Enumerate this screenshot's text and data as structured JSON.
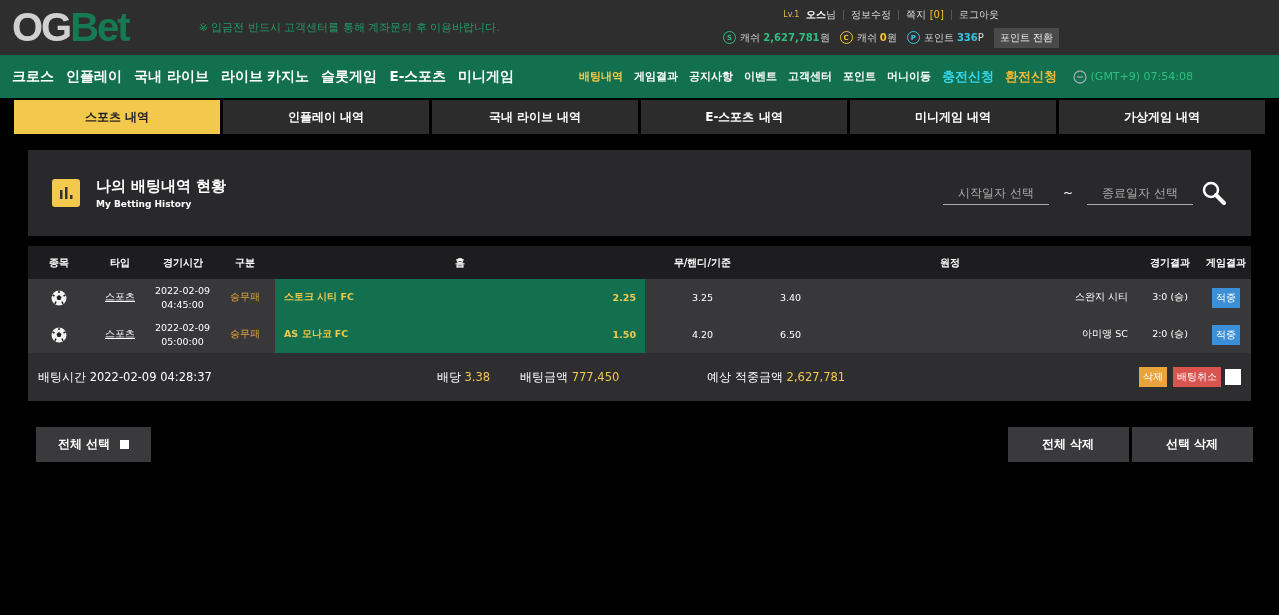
{
  "logo": {
    "part_1": "OG",
    "part_2": "Bet"
  },
  "notice": "※ 입금전 반드시 고객센터를 통해 계좌문의 후 이용바랍니다.",
  "user": {
    "level": "Lv.1",
    "name": "오스",
    "suffix": "님",
    "links": [
      "정보수정",
      "쪽지",
      "로그아웃"
    ],
    "message_count": "[0]"
  },
  "wallet": [
    {
      "kind": "s",
      "icon": "S",
      "label": "캐쉬",
      "amount": "2,627,781",
      "unit": "원"
    },
    {
      "kind": "c",
      "icon": "C",
      "label": "캐쉬",
      "amount": "0",
      "unit": "원"
    },
    {
      "kind": "p",
      "icon": "P",
      "label": "포인트",
      "amount": "336",
      "unit": "P"
    }
  ],
  "convert_button": "포인트 전환",
  "main_nav": [
    "크로스",
    "인플레이",
    "국내 라이브",
    "라이브 카지노",
    "슬롯게임",
    "E-스포츠",
    "미니게임"
  ],
  "sub_nav": [
    {
      "label": "배팅내역",
      "kind": "normal",
      "selected": true
    },
    {
      "label": "게임결과",
      "kind": "normal",
      "selected": false
    },
    {
      "label": "공지사항",
      "kind": "normal",
      "selected": false
    },
    {
      "label": "이벤트",
      "kind": "normal",
      "selected": false
    },
    {
      "label": "고객센터",
      "kind": "normal",
      "selected": false
    },
    {
      "label": "포인트",
      "kind": "normal",
      "selected": false
    },
    {
      "label": "머니이동",
      "kind": "normal",
      "selected": false
    },
    {
      "label": "충전신청",
      "kind": "charge",
      "selected": false
    },
    {
      "label": "환전신청",
      "kind": "exchange",
      "selected": false
    }
  ],
  "clock": "(GMT+9)  07:54:08",
  "tabs": [
    {
      "label": "스포츠 내역",
      "selected": true
    },
    {
      "label": "인플레이 내역",
      "selected": false
    },
    {
      "label": "국내 라이브 내역",
      "selected": false
    },
    {
      "label": "E-스포츠 내역",
      "selected": false
    },
    {
      "label": "미니게임 내역",
      "selected": false
    },
    {
      "label": "가상게임 내역",
      "selected": false
    }
  ],
  "panel": {
    "title": "나의 배팅내역 현황",
    "subtitle": "My Betting History",
    "start_placeholder": "시작일자 선택",
    "separator": "~",
    "end_placeholder": "종료일자 선택"
  },
  "table": {
    "columns": [
      "종목",
      "타입",
      "경기시간",
      "구분",
      "홈",
      "무/핸디/기준",
      "원정",
      "경기결과",
      "게임결과"
    ],
    "rows": [
      {
        "type": "스포츠",
        "date": "2022-02-09",
        "time": "04:45:00",
        "category": "승무패",
        "home": "스토크 시티 FC",
        "home_odds": "2.25",
        "home_selected": true,
        "draw": "3.25",
        "away_odds": "3.40",
        "away": "스완지 시티",
        "score": "3:0 (승)",
        "result": "적중"
      },
      {
        "type": "스포츠",
        "date": "2022-02-09",
        "time": "05:00:00",
        "category": "승무패",
        "home": "AS 모나코 FC",
        "home_odds": "1.50",
        "home_selected": true,
        "draw": "4.20",
        "away_odds": "6.50",
        "away": "아미앵 SC",
        "score": "2:0 (승)",
        "result": "적중"
      }
    ]
  },
  "summary": {
    "bet_time_label": "배팅시간",
    "bet_time": "2022-02-09 04:28:37",
    "odds_label": "배당",
    "odds": "3.38",
    "amount_label": "배팅금액",
    "amount": "777,450",
    "expected_label": "예상 적중금액",
    "expected": "2,627,781",
    "delete_button": "삭제",
    "cancel_button": "배팅취소",
    "checked": false
  },
  "bottom": {
    "select_all": "전체 선택",
    "select_all_checked": false,
    "delete_all": "전체 삭제",
    "delete_selected": "선택 삭제"
  }
}
